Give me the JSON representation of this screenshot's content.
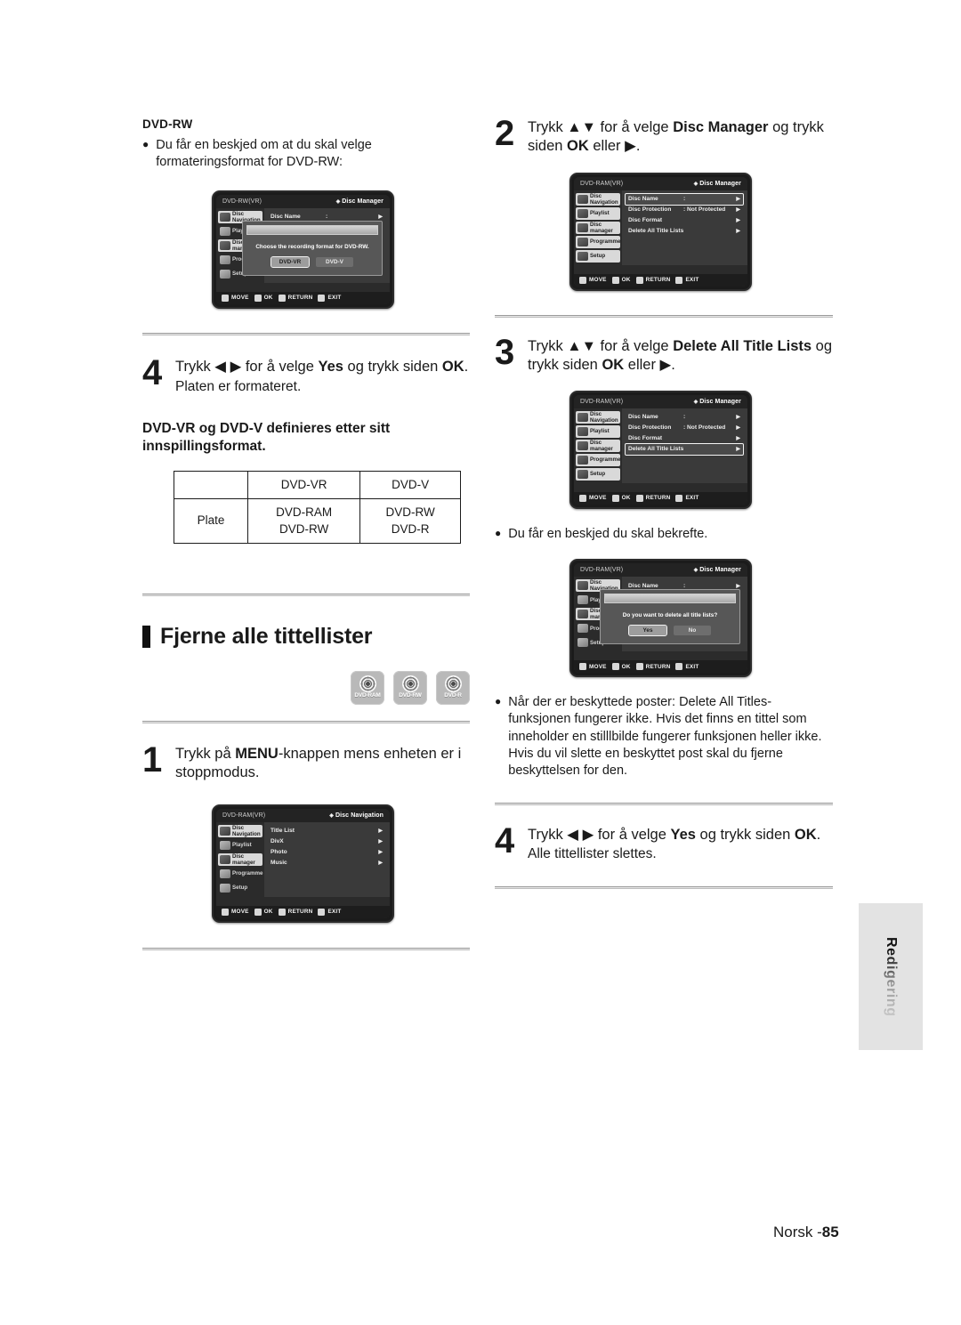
{
  "page": {
    "footer_label": "Norsk -",
    "footer_number": "85",
    "side_tab": "Redigering"
  },
  "left": {
    "kicker": "DVD-RW",
    "bullet": "Du får en beskjed om at du skal velge formateringsformat for DVD-RW:",
    "osd1": {
      "disc_label": "DVD-RW(VR)",
      "screen_title": "Disc Manager",
      "sidebar": [
        "Disc Navigation",
        "Playlist",
        "Disc manager",
        "Programme",
        "Setup"
      ],
      "row_name": "Disc Name",
      "row_colon": ":",
      "dialog_message": "Choose the recording format for DVD-RW.",
      "btn_yes": "DVD-VR",
      "btn_no": "DVD-V",
      "foot": [
        "MOVE",
        "OK",
        "RETURN",
        "EXIT"
      ]
    },
    "step4": {
      "num": "4",
      "line1_pre": "Trykk ",
      "line1_arrows": "◀ ▶",
      "line1_mid": " for å velge ",
      "line1_bold": "Yes",
      "line1_post": " og trykk siden ",
      "line1_ok": "OK",
      "line1_end": ".",
      "line2": "Platen er formateret."
    },
    "note": "DVD-VR og DVD-V definieres etter sitt innspillingsformat.",
    "table": {
      "headers": [
        "",
        "DVD-VR",
        "DVD-V"
      ],
      "row_label": "Plate",
      "col_vr": [
        "DVD-RAM",
        "DVD-RW"
      ],
      "col_v": [
        "DVD-RW",
        "DVD-R"
      ]
    },
    "section_title": "Fjerne alle tittellister",
    "badges": [
      "DVD-RAM",
      "DVD-RW",
      "DVD-R"
    ],
    "step1": {
      "num": "1",
      "pre": "Trykk på ",
      "bold": "MENU",
      "post": "-knappen mens enheten er i stoppmodus."
    },
    "osd2": {
      "disc_label": "DVD-RAM(VR)",
      "screen_title": "Disc Navigation",
      "sidebar": [
        "Disc Navigation",
        "Playlist",
        "Disc manager",
        "Programme",
        "Setup"
      ],
      "items": [
        "Title List",
        "DivX",
        "Photo",
        "Music"
      ],
      "foot": [
        "MOVE",
        "OK",
        "RETURN",
        "EXIT"
      ]
    }
  },
  "right": {
    "step2": {
      "num": "2",
      "pre": "Trykk ",
      "arrows": "▲▼",
      "mid": " for å velge ",
      "bold": "Disc Manager",
      "post": " og trykk siden ",
      "ok": "OK",
      "end": " eller ▶."
    },
    "osd3": {
      "disc_label": "DVD-RAM(VR)",
      "screen_title": "Disc Manager",
      "sidebar": [
        "Disc Navigation",
        "Playlist",
        "Disc manager",
        "Programme",
        "Setup"
      ],
      "rows": [
        {
          "name": "Disc Name",
          "value": ":",
          "selected": true
        },
        {
          "name": "Disc Protection",
          "value": ": Not Protected",
          "selected": false
        },
        {
          "name": "Disc Format",
          "value": "",
          "selected": false
        },
        {
          "name": "Delete All Title Lists",
          "value": "",
          "selected": false
        }
      ],
      "foot": [
        "MOVE",
        "OK",
        "RETURN",
        "EXIT"
      ]
    },
    "step3": {
      "num": "3",
      "pre": "Trykk ",
      "arrows": "▲▼",
      "mid": " for å velge ",
      "bold": "Delete All Title Lists",
      "post": " og trykk siden ",
      "ok": "OK",
      "end": " eller ▶."
    },
    "osd4": {
      "disc_label": "DVD-RAM(VR)",
      "screen_title": "Disc Manager",
      "sidebar": [
        "Disc Navigation",
        "Playlist",
        "Disc manager",
        "Programme",
        "Setup"
      ],
      "rows": [
        {
          "name": "Disc Name",
          "value": ":",
          "selected": false
        },
        {
          "name": "Disc Protection",
          "value": ": Not Protected",
          "selected": false
        },
        {
          "name": "Disc Format",
          "value": "",
          "selected": false
        },
        {
          "name": "Delete All Title Lists",
          "value": "",
          "selected": true
        }
      ],
      "foot": [
        "MOVE",
        "OK",
        "RETURN",
        "EXIT"
      ]
    },
    "bullet1": "Du får en beskjed du skal bekrefte.",
    "osd5": {
      "disc_label": "DVD-RAM(VR)",
      "screen_title": "Disc Manager",
      "sidebar": [
        "Disc Navigation",
        "Playlist",
        "Disc manager",
        "Programme",
        "Setup"
      ],
      "row_name": "Disc Name",
      "row_colon": ":",
      "dialog_message": "Do you want to delete all title lists?",
      "btn_yes": "Yes",
      "btn_no": "No",
      "foot": [
        "MOVE",
        "OK",
        "RETURN",
        "EXIT"
      ]
    },
    "bullet2": "Når der er beskyttede poster: Delete All Titles-funksjonen fungerer ikke. Hvis det finns en tittel som inneholder en stilllbilde fungerer funksjonen heller ikke. Hvis du vil slette en beskyttet post skal du fjerne beskyttelsen for den.",
    "step4": {
      "num": "4",
      "pre": "Trykk ",
      "arrows": "◀ ▶",
      "mid": " for å velge ",
      "bold": "Yes",
      "post": " og trykk siden ",
      "ok": "OK",
      "end": ".",
      "line2": "Alle tittellister slettes."
    }
  }
}
